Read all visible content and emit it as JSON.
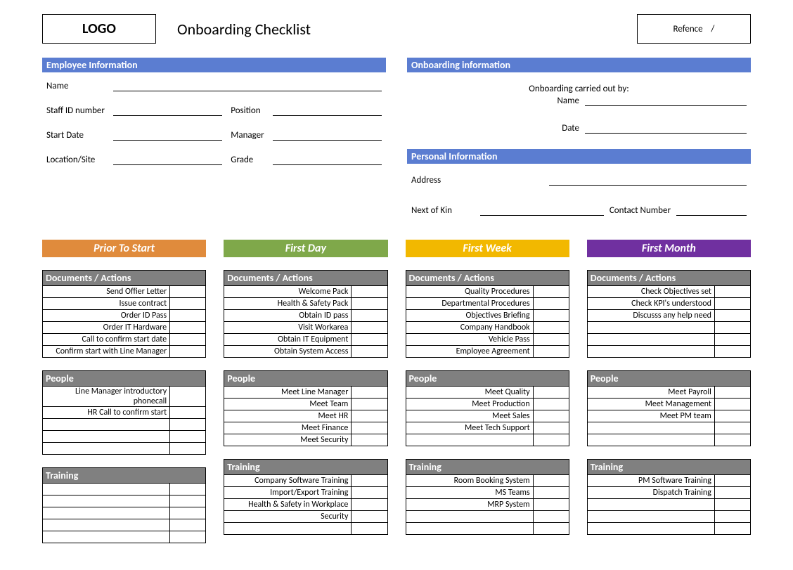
{
  "header": {
    "logo": "LOGO",
    "title": "Onboarding Checklist",
    "reference_label": "Refence",
    "reference_sep": "/"
  },
  "employee_info": {
    "header": "Employee Information",
    "name": "Name",
    "staff_id": "Staff ID number",
    "position": "Position",
    "start_date": "Start Date",
    "manager": "Manager",
    "location": "Location/Site",
    "grade": "Grade"
  },
  "onboarding_info": {
    "header": "Onboarding information",
    "carried_out": "Onboarding carried out by:",
    "name": "Name",
    "date": "Date"
  },
  "personal_info": {
    "header": "Personal Information",
    "address": "Address",
    "next_of_kin": "Next of Kin",
    "contact": "Contact Number"
  },
  "phases": [
    {
      "title": "Prior To Start",
      "colorClass": "orange",
      "blocks": [
        {
          "header": "Documents / Actions",
          "rows": 6,
          "items": [
            "Send Offier Letter",
            "Issue contract",
            "Order ID Pass",
            "Order IT Hardware",
            "Call to confirm start date",
            "Confirm start with Line Manager"
          ]
        },
        {
          "header": "People",
          "rows": 5,
          "items": [
            "Line Manager introductory phonecall",
            "HR Call to confirm start"
          ]
        },
        {
          "header": "Training",
          "rows": 5,
          "items": []
        }
      ]
    },
    {
      "title": "First Day",
      "colorClass": "green",
      "blocks": [
        {
          "header": "Documents / Actions",
          "rows": 6,
          "items": [
            "Welcome Pack",
            "Health & Safety Pack",
            "Obtain ID pass",
            "Visit Workarea",
            "Obtain IT Equipment",
            "Obtain System Access"
          ]
        },
        {
          "header": "People",
          "rows": 5,
          "items": [
            "Meet Line Manager",
            "Meet Team",
            "Meet HR",
            "Meet Finance",
            "Meet Security"
          ]
        },
        {
          "header": "Training",
          "rows": 5,
          "items": [
            "Company Software Training",
            "Import/Export Training",
            "Health & Safety in Workplace",
            "Security"
          ]
        }
      ]
    },
    {
      "title": "First Week",
      "colorClass": "yellow",
      "blocks": [
        {
          "header": "Documents / Actions",
          "rows": 6,
          "items": [
            "Quality Procedures",
            "Departmental Procedures",
            "Objectives Briefing",
            "Company Handbook",
            "Vehicle Pass",
            "Employee Agreement"
          ]
        },
        {
          "header": "People",
          "rows": 5,
          "items": [
            "Meet Quality",
            "Meet Production",
            "Meet Sales",
            "Meet Tech Support"
          ]
        },
        {
          "header": "Training",
          "rows": 5,
          "items": [
            "Room Booking System",
            "MS Teams",
            "MRP System"
          ]
        }
      ]
    },
    {
      "title": "First Month",
      "colorClass": "purple",
      "blocks": [
        {
          "header": "Documents / Actions",
          "rows": 6,
          "items": [
            "Check Objectives set",
            "Check KPI's understood",
            "Discusss any help need"
          ]
        },
        {
          "header": "People",
          "rows": 5,
          "items": [
            "Meet Payroll",
            "Meet Management",
            "Meet PM team"
          ]
        },
        {
          "header": "Training",
          "rows": 5,
          "items": [
            "PM Software Training",
            "Dispatch Training"
          ]
        }
      ]
    }
  ]
}
